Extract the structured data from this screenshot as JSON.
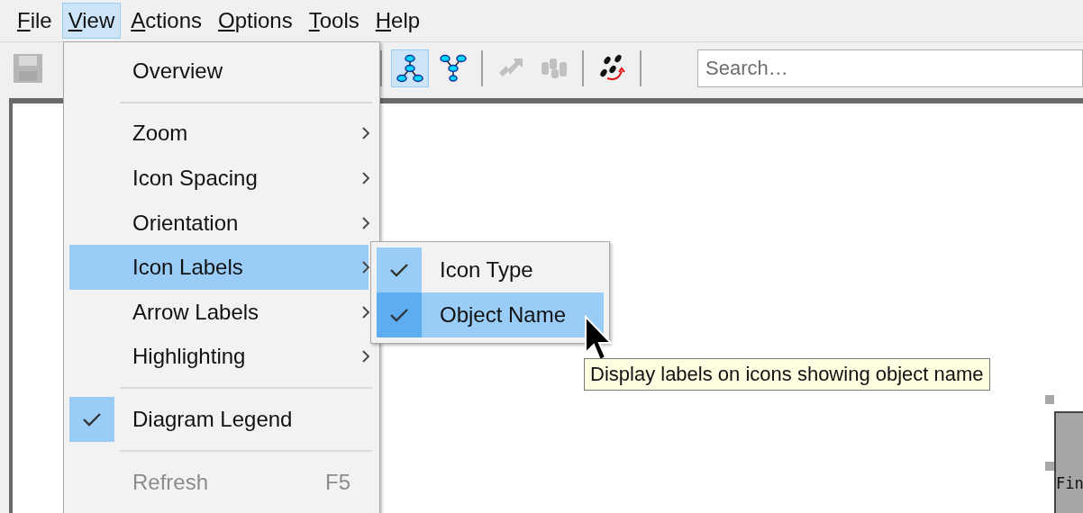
{
  "menu_bar": [
    {
      "label": "File",
      "selected": false
    },
    {
      "label": "View",
      "selected": true
    },
    {
      "label": "Actions",
      "selected": false
    },
    {
      "label": "Options",
      "selected": false
    },
    {
      "label": "Tools",
      "selected": false
    },
    {
      "label": "Help",
      "selected": false
    }
  ],
  "toolbar": {
    "buttons": [
      {
        "kind": "save",
        "selected": false,
        "disabled": true
      },
      {
        "kind": "separator"
      },
      {
        "kind": "layout-down",
        "selected": true,
        "disabled": false
      },
      {
        "kind": "layout-up",
        "selected": false,
        "disabled": false
      },
      {
        "kind": "separator"
      },
      {
        "kind": "swap",
        "selected": false,
        "disabled": true
      },
      {
        "kind": "network",
        "selected": false,
        "disabled": true
      },
      {
        "kind": "separator"
      },
      {
        "kind": "steps",
        "selected": false,
        "disabled": false
      },
      {
        "kind": "separator"
      }
    ],
    "search": {
      "placeholder": "Search…"
    }
  },
  "view_menu": {
    "items": [
      {
        "kind": "item",
        "label": "Overview",
        "submenu": false,
        "checked": false,
        "selected": false,
        "disabled": false
      },
      {
        "kind": "separator"
      },
      {
        "kind": "item",
        "label": "Zoom",
        "submenu": true,
        "checked": false,
        "selected": false,
        "disabled": false
      },
      {
        "kind": "item",
        "label": "Icon Spacing",
        "submenu": true,
        "checked": false,
        "selected": false,
        "disabled": false
      },
      {
        "kind": "item",
        "label": "Orientation",
        "submenu": true,
        "checked": false,
        "selected": false,
        "disabled": false
      },
      {
        "kind": "item",
        "label": "Icon Labels",
        "submenu": true,
        "checked": false,
        "selected": true,
        "disabled": false
      },
      {
        "kind": "item",
        "label": "Arrow Labels",
        "submenu": true,
        "checked": false,
        "selected": false,
        "disabled": false
      },
      {
        "kind": "item",
        "label": "Highlighting",
        "submenu": true,
        "checked": false,
        "selected": false,
        "disabled": false
      },
      {
        "kind": "separator"
      },
      {
        "kind": "item",
        "label": "Diagram Legend",
        "submenu": false,
        "checked": true,
        "selected": false,
        "disabled": false
      },
      {
        "kind": "separator"
      },
      {
        "kind": "item",
        "label": "Refresh",
        "shortcut": "F5",
        "submenu": false,
        "checked": false,
        "selected": false,
        "disabled": true
      }
    ]
  },
  "icon_labels_submenu": {
    "items": [
      {
        "label": "Icon Type",
        "checked": true,
        "selected": false
      },
      {
        "label": "Object Name",
        "checked": true,
        "selected": true
      }
    ]
  },
  "tooltip": {
    "text": "Display labels on icons showing object name"
  },
  "diagram": {
    "node": {
      "label": "Fin"
    }
  }
}
